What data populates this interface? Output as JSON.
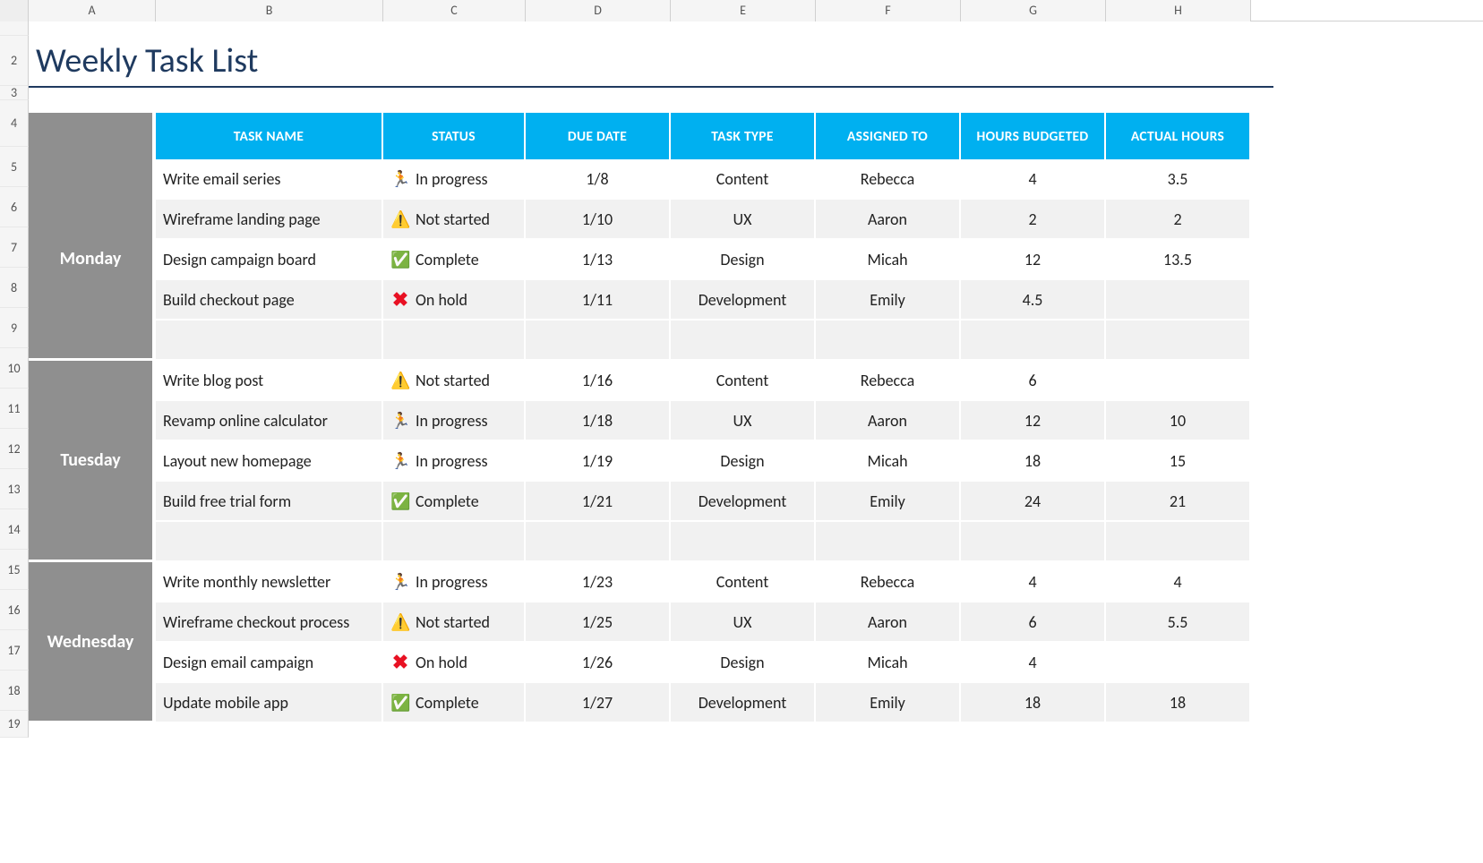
{
  "columns": [
    "A",
    "B",
    "C",
    "D",
    "E",
    "F",
    "G",
    "H"
  ],
  "row_labels": [
    "",
    "2",
    "3",
    "4",
    "5",
    "6",
    "7",
    "8",
    "9",
    "10",
    "11",
    "12",
    "13",
    "14",
    "15",
    "16",
    "17",
    "18",
    "19"
  ],
  "title": "Weekly Task List",
  "headers": {
    "task_name": "TASK NAME",
    "status": "STATUS",
    "due_date": "DUE DATE",
    "task_type": "TASK TYPE",
    "assigned_to": "ASSIGNED TO",
    "hours_budgeted": "HOURS BUDGETED",
    "actual_hours": "ACTUAL HOURS"
  },
  "status_labels": {
    "in_progress": "In progress",
    "not_started": "Not started",
    "complete": "Complete",
    "on_hold": "On hold"
  },
  "status_icons": {
    "in_progress": "🏃",
    "not_started": "⚠️",
    "complete": "✅",
    "on_hold": "✖"
  },
  "days": [
    {
      "name": "Monday",
      "rows": [
        {
          "task": "Write email series",
          "status": "in_progress",
          "due": "1/8",
          "type": "Content",
          "assigned": "Rebecca",
          "budget": "4",
          "actual": "3.5"
        },
        {
          "task": "Wireframe landing page",
          "status": "not_started",
          "due": "1/10",
          "type": "UX",
          "assigned": "Aaron",
          "budget": "2",
          "actual": "2"
        },
        {
          "task": "Design campaign board",
          "status": "complete",
          "due": "1/13",
          "type": "Design",
          "assigned": "Micah",
          "budget": "12",
          "actual": "13.5"
        },
        {
          "task": "Build checkout page",
          "status": "on_hold",
          "due": "1/11",
          "type": "Development",
          "assigned": "Emily",
          "budget": "4.5",
          "actual": ""
        }
      ]
    },
    {
      "name": "Tuesday",
      "rows": [
        {
          "task": "Write blog post",
          "status": "not_started",
          "due": "1/16",
          "type": "Content",
          "assigned": "Rebecca",
          "budget": "6",
          "actual": ""
        },
        {
          "task": "Revamp online calculator",
          "status": "in_progress",
          "due": "1/18",
          "type": "UX",
          "assigned": "Aaron",
          "budget": "12",
          "actual": "10"
        },
        {
          "task": "Layout new homepage",
          "status": "in_progress",
          "due": "1/19",
          "type": "Design",
          "assigned": "Micah",
          "budget": "18",
          "actual": "15"
        },
        {
          "task": "Build free trial form",
          "status": "complete",
          "due": "1/21",
          "type": "Development",
          "assigned": "Emily",
          "budget": "24",
          "actual": "21"
        }
      ]
    },
    {
      "name": "Wednesday",
      "rows": [
        {
          "task": "Write monthly newsletter",
          "status": "in_progress",
          "due": "1/23",
          "type": "Content",
          "assigned": "Rebecca",
          "budget": "4",
          "actual": "4"
        },
        {
          "task": "Wireframe checkout process",
          "status": "not_started",
          "due": "1/25",
          "type": "UX",
          "assigned": "Aaron",
          "budget": "6",
          "actual": "5.5"
        },
        {
          "task": "Design email campaign",
          "status": "on_hold",
          "due": "1/26",
          "type": "Design",
          "assigned": "Micah",
          "budget": "4",
          "actual": ""
        },
        {
          "task": "Update mobile app",
          "status": "complete",
          "due": "1/27",
          "type": "Development",
          "assigned": "Emily",
          "budget": "18",
          "actual": "18"
        }
      ]
    }
  ]
}
